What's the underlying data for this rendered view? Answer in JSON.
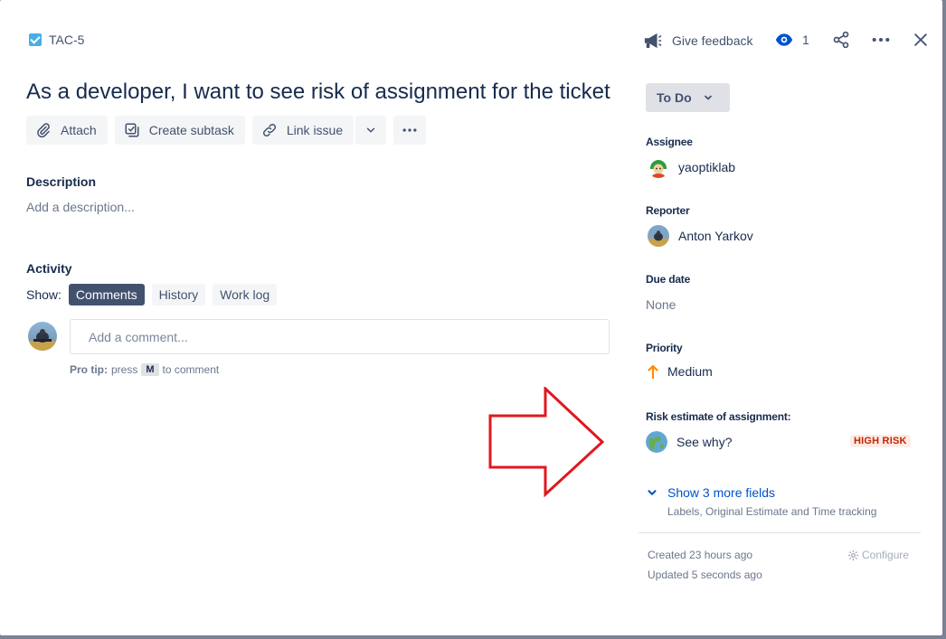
{
  "issue": {
    "key": "TAC-5",
    "title": "As a developer, I want to see risk of assignment for the ticket"
  },
  "toolbar": {
    "attach": "Attach",
    "create_subtask": "Create subtask",
    "link_issue": "Link issue"
  },
  "description": {
    "heading": "Description",
    "placeholder": "Add a description..."
  },
  "activity": {
    "heading": "Activity",
    "show_label": "Show:",
    "tabs": [
      "Comments",
      "History",
      "Work log"
    ],
    "active_tab": "Comments",
    "comment_placeholder": "Add a comment...",
    "protip_prefix": "Pro tip:",
    "protip_press": "press",
    "protip_key": "M",
    "protip_suffix": "to comment"
  },
  "header": {
    "give_feedback": "Give feedback",
    "watch_count": "1"
  },
  "sidebar": {
    "status": "To Do",
    "assignee_label": "Assignee",
    "assignee": "yaoptiklab",
    "reporter_label": "Reporter",
    "reporter": "Anton Yarkov",
    "due_date_label": "Due date",
    "due_date": "None",
    "priority_label": "Priority",
    "priority": "Medium",
    "risk_label": "Risk estimate of assignment:",
    "risk_link": "See why?",
    "risk_badge": "HIGH RISK",
    "more_fields": "Show 3 more fields",
    "more_fields_sub": "Labels, Original Estimate and Time tracking",
    "created": "Created 23 hours ago",
    "updated": "Updated 5 seconds ago",
    "configure": "Configure"
  },
  "colors": {
    "accent": "#0052cc",
    "risk": "#bf2600",
    "arrow": "#e0171f",
    "priority_medium": "#ff8b00"
  }
}
